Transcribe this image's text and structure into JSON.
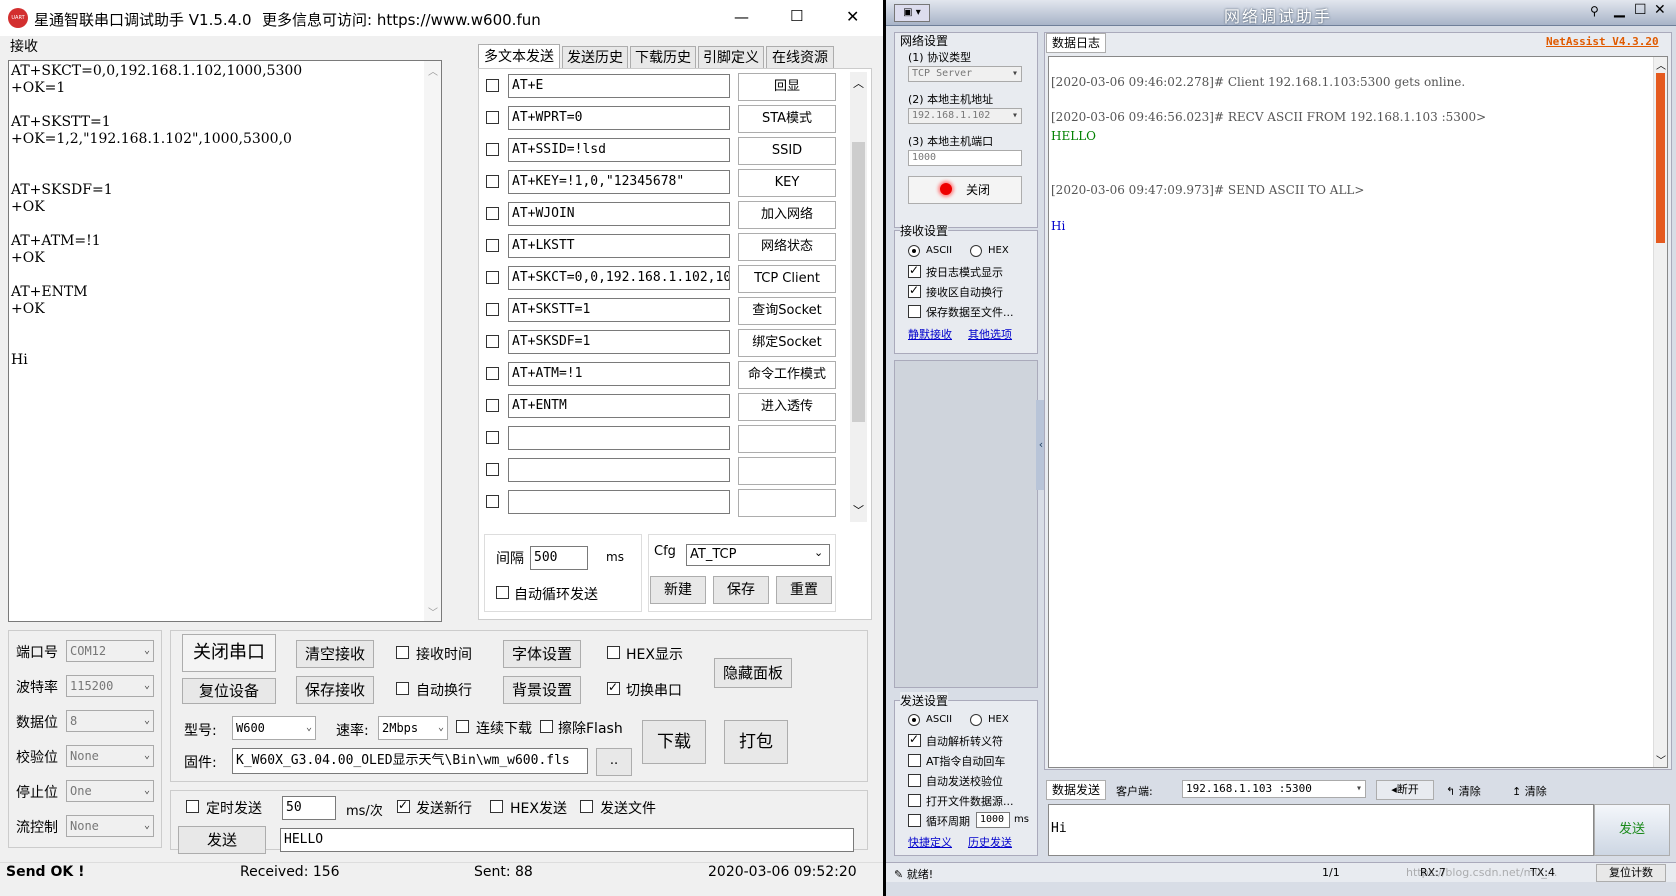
{
  "left_app": {
    "title": "星通智联串口调试助手 V1.5.4.0",
    "more_info": "更多信息可访问: https://www.w600.fun",
    "logo_text": "UART",
    "win_controls": [
      "—",
      "☐",
      "✕"
    ],
    "receive_label": "接收",
    "receive_lines": [
      "AT+SKCT=0,0,192.168.1.102,1000,5300",
      "+OK=1",
      "",
      "AT+SKSTT=1",
      "+OK=1,2,\"192.168.1.102\",1000,5300,0",
      "",
      "",
      "AT+SKSDF=1",
      "+OK",
      "",
      "AT+ATM=!1",
      "+OK",
      "",
      "AT+ENTM",
      "+OK",
      "",
      "",
      "Hi"
    ],
    "tabs": [
      "多文本发送",
      "发送历史",
      "下载历史",
      "引脚定义",
      "在线资源"
    ],
    "multi_rows": [
      {
        "cmd": "AT+E",
        "btn": "回显"
      },
      {
        "cmd": "AT+WPRT=0",
        "btn": "STA模式"
      },
      {
        "cmd": "AT+SSID=!lsd",
        "btn": "SSID"
      },
      {
        "cmd": "AT+KEY=!1,0,\"12345678\"",
        "btn": "KEY"
      },
      {
        "cmd": "AT+WJOIN",
        "btn": "加入网络"
      },
      {
        "cmd": "AT+LKSTT",
        "btn": "网络状态"
      },
      {
        "cmd": "AT+SKCT=0,0,192.168.1.102,10",
        "btn": "TCP Client"
      },
      {
        "cmd": "AT+SKSTT=1",
        "btn": "查询Socket"
      },
      {
        "cmd": "AT+SKSDF=1",
        "btn": "绑定Socket"
      },
      {
        "cmd": "AT+ATM=!1",
        "btn": "命令工作模式"
      },
      {
        "cmd": "AT+ENTM",
        "btn": "进入透传"
      },
      {
        "cmd": "",
        "btn": ""
      },
      {
        "cmd": "",
        "btn": ""
      },
      {
        "cmd": "",
        "btn": ""
      }
    ],
    "interval_label": "间隔",
    "interval_value": "500",
    "interval_unit": "ms",
    "auto_loop_label": "自动循环发送",
    "cfg_label": "Cfg",
    "cfg_value": "AT_TCP",
    "new_btn": "新建",
    "save_btn": "保存",
    "reset_btn": "重置",
    "port_settings": [
      {
        "label": "端口号",
        "value": "COM12"
      },
      {
        "label": "波特率",
        "value": "115200"
      },
      {
        "label": "数据位",
        "value": "8"
      },
      {
        "label": "校验位",
        "value": "None"
      },
      {
        "label": "停止位",
        "value": "One"
      },
      {
        "label": "流控制",
        "value": "None"
      }
    ],
    "close_port_btn": "关闭串口",
    "reset_device_btn": "复位设备",
    "clear_recv_btn": "清空接收",
    "save_recv_btn": "保存接收",
    "recv_time_label": "接收时间",
    "auto_wrap_label": "自动换行",
    "font_btn": "字体设置",
    "bg_btn": "背景设置",
    "hex_display_label": "HEX显示",
    "switch_port_label": "切换串口",
    "hide_panel_btn": "隐藏面板",
    "model_label": "型号:",
    "model_value": "W600",
    "rate_label": "速率:",
    "rate_value": "2Mbps",
    "cont_download_label": "连续下载",
    "erase_flash_label": "擦除Flash",
    "firmware_label": "固件:",
    "firmware_value": "K_W60X_G3.04.00_OLED显示天气\\Bin\\wm_w600.fls",
    "browse_btn": "..",
    "download_btn": "下载",
    "pack_btn": "打包",
    "timed_send_label": "定时发送",
    "timed_value": "50",
    "timed_unit": "ms/次",
    "send_newline_label": "发送新行",
    "hex_send_label": "HEX发送",
    "send_file_label": "发送文件",
    "send_btn": "发送",
    "send_text": "HELLO",
    "status": {
      "send": "Send OK !",
      "received": "Received: 156",
      "sent": "Sent: 88",
      "time": "2020-03-06 09:52:20"
    }
  },
  "right_app": {
    "title": "网络调试助手",
    "version": "NetAssist V4.3.20",
    "net_settings_label": "网络设置",
    "protocol_label": "(1) 协议类型",
    "protocol_value": "TCP Server",
    "host_addr_label": "(2) 本地主机地址",
    "host_addr_value": "192.168.1.102",
    "host_port_label": "(3) 本地主机端口",
    "host_port_value": "1000",
    "close_btn": "关闭",
    "recv_settings_label": "接收设置",
    "ascii": "ASCII",
    "hex": "HEX",
    "log_mode_label": "按日志模式显示",
    "auto_newline_label": "接收区自动换行",
    "save_to_file_label": "保存数据至文件...",
    "silent_recv_link": "静默接收",
    "other_options_link": "其他选项",
    "send_settings_label": "发送设置",
    "auto_escape_label": "自动解析转义符",
    "at_cr_label": "AT指令自动回车",
    "auto_checksum_label": "自动发送校验位",
    "open_file_label": "打开文件数据源...",
    "loop_period_label": "循环周期",
    "loop_period_value": "1000",
    "loop_period_unit": "ms",
    "shortcut_link": "快捷定义",
    "history_link": "历史发送",
    "log_tab": "数据日志",
    "log_entries": [
      {
        "text": "[2020-03-06 09:46:02.278]# Client 192.168.1.103:5300 gets online.",
        "color": "#555555"
      },
      {
        "text": "[2020-03-06 09:46:56.023]# RECV ASCII FROM 192.168.1.103 :5300>",
        "color": "#555555"
      },
      {
        "text": "HELLO",
        "color": "#008000"
      },
      {
        "text": "[2020-03-06 09:47:09.973]# SEND ASCII TO ALL>",
        "color": "#555555"
      },
      {
        "text": "Hi",
        "color": "#0000cc"
      }
    ],
    "data_send_tab": "数据发送",
    "client_label": "客户端:",
    "client_value": "192.168.1.103 :5300",
    "disconnect_btn": "断开",
    "clear_btn_1": "清除",
    "clear_btn_2": "清除",
    "send_input": "Hi",
    "send_btn": "发送",
    "status_ready": "就绪!",
    "status_page": "1/1",
    "status_rx": "RX:7",
    "status_tx": "TX:4",
    "reset_count": "复位计数",
    "watermark": "https://blog.csdn.net/m0_..."
  }
}
